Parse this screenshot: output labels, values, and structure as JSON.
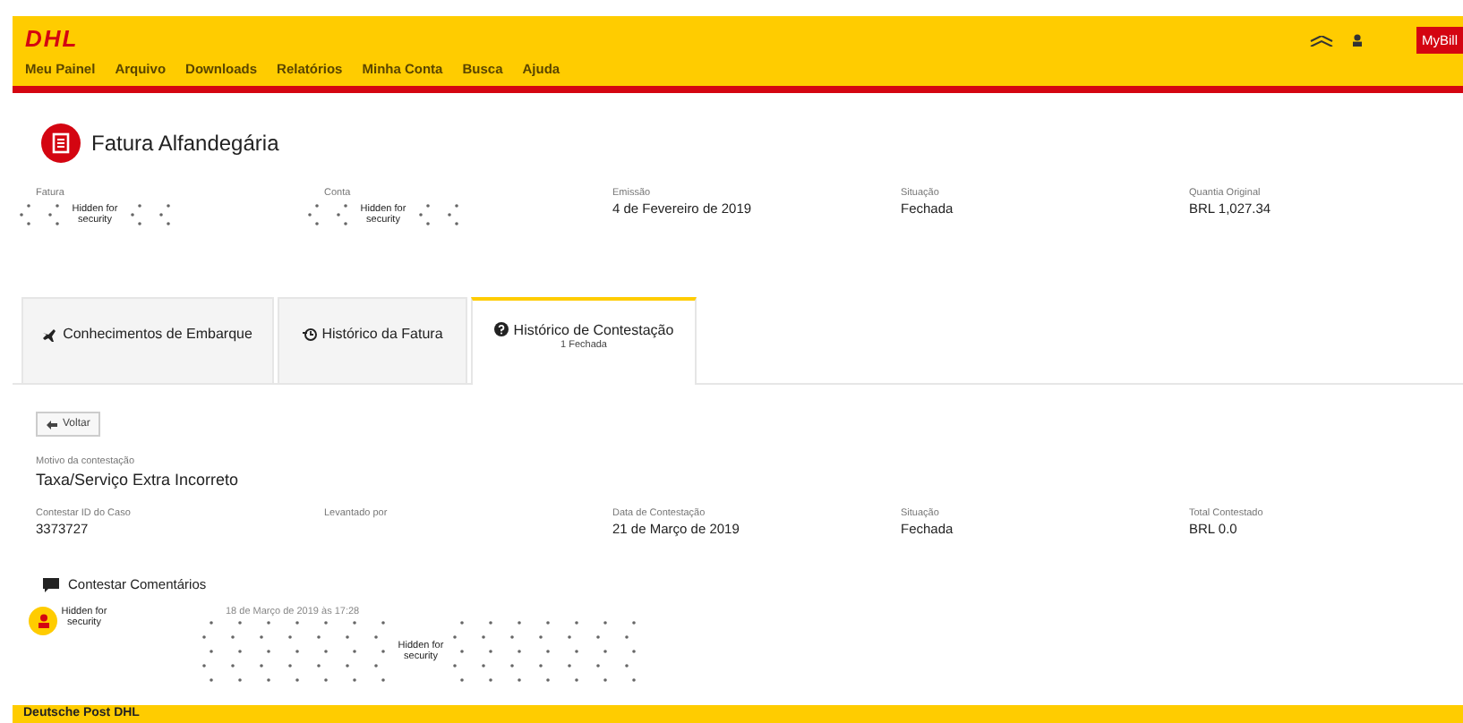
{
  "header": {
    "logo": "DHL",
    "nav": [
      "Meu Painel",
      "Arquivo",
      "Downloads",
      "Relatórios",
      "Minha Conta",
      "Busca",
      "Ajuda"
    ],
    "app_button": "MyBill"
  },
  "page_title": "Fatura Alfandegária",
  "summary": [
    {
      "label": "Fatura",
      "kind": "redacted",
      "value": "Hidden for security"
    },
    {
      "label": "Conta",
      "kind": "redacted",
      "value": "Hidden for security"
    },
    {
      "label": "Emissão",
      "kind": "text",
      "value": "4 de Fevereiro de 2019"
    },
    {
      "label": "Situação",
      "kind": "text",
      "value": "Fechada"
    },
    {
      "label": "Quantia Original",
      "kind": "text",
      "value": "BRL 1,027.34"
    }
  ],
  "tabs": [
    {
      "label": "Conhecimentos de Embarque",
      "selected": false
    },
    {
      "label": "Histórico da Fatura",
      "selected": false
    },
    {
      "label": "Histórico de Contestação",
      "sublabel": "1 Fechada",
      "selected": true
    }
  ],
  "back_button": "Voltar",
  "reason": {
    "label": "Motivo da contestação",
    "value": "Taxa/Serviço Extra Incorreto"
  },
  "details": [
    {
      "label": "Contestar ID do Caso",
      "value": "3373727"
    },
    {
      "label": "Levantado por"
    },
    {
      "label": "Data de Contestação",
      "value": "21 de Março de 2019"
    },
    {
      "label": "Situação",
      "value": "Fechada"
    },
    {
      "label": "Total Contestado",
      "value": "BRL 0.0"
    }
  ],
  "comments": {
    "title": "Contestar Comentários",
    "items": [
      {
        "author": "Hidden for security",
        "time": "18 de Março de 2019 às 17:28",
        "body": "Hidden for security"
      }
    ]
  },
  "footer": "Deutsche Post DHL"
}
